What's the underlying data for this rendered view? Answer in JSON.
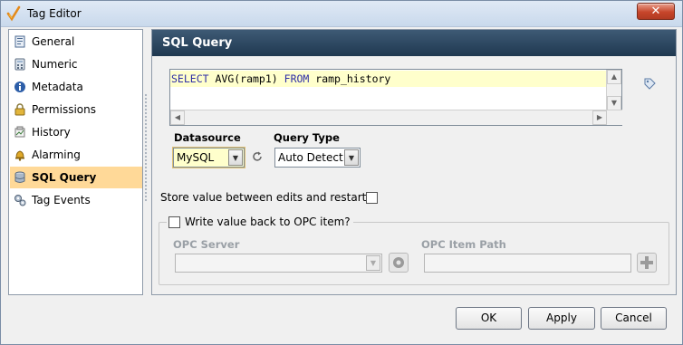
{
  "window": {
    "title": "Tag Editor",
    "close_glyph": "✕"
  },
  "sidebar": {
    "items": [
      {
        "label": "General",
        "icon": "general-icon",
        "selected": false
      },
      {
        "label": "Numeric",
        "icon": "numeric-icon",
        "selected": false
      },
      {
        "label": "Metadata",
        "icon": "metadata-icon",
        "selected": false
      },
      {
        "label": "Permissions",
        "icon": "lock-icon",
        "selected": false
      },
      {
        "label": "History",
        "icon": "history-icon",
        "selected": false
      },
      {
        "label": "Alarming",
        "icon": "bell-icon",
        "selected": false
      },
      {
        "label": "SQL Query",
        "icon": "database-icon",
        "selected": true
      },
      {
        "label": "Tag Events",
        "icon": "gears-icon",
        "selected": false
      }
    ]
  },
  "panel": {
    "title": "SQL Query",
    "query": {
      "kw_select": "SELECT",
      "part1": " AVG(ramp1) ",
      "kw_from": "FROM",
      "part2": " ramp_history"
    },
    "datasource": {
      "label": "Datasource",
      "value": "MySQL"
    },
    "query_type": {
      "label": "Query Type",
      "value": "Auto Detect"
    },
    "store_value_label": "Store value between edits and restarts:",
    "store_value_checked": false,
    "write_back": {
      "label": "Write value back to OPC item?",
      "checked": false,
      "opc_server_label": "OPC Server",
      "opc_server_value": "",
      "opc_item_path_label": "OPC Item Path",
      "opc_item_path_value": ""
    }
  },
  "footer": {
    "ok_label": "OK",
    "ok_mnemonic": "O",
    "apply_label": "Apply",
    "apply_mnemonic": "A",
    "cancel_label": "Cancel",
    "cancel_mnemonic": "C"
  },
  "colors": {
    "header_bg": "#2c4761",
    "selected_item_bg": "#ffd998",
    "active_field_bg": "#ffffcc",
    "sql_keyword": "#2f2fa6",
    "close_button": "#c7462b"
  }
}
